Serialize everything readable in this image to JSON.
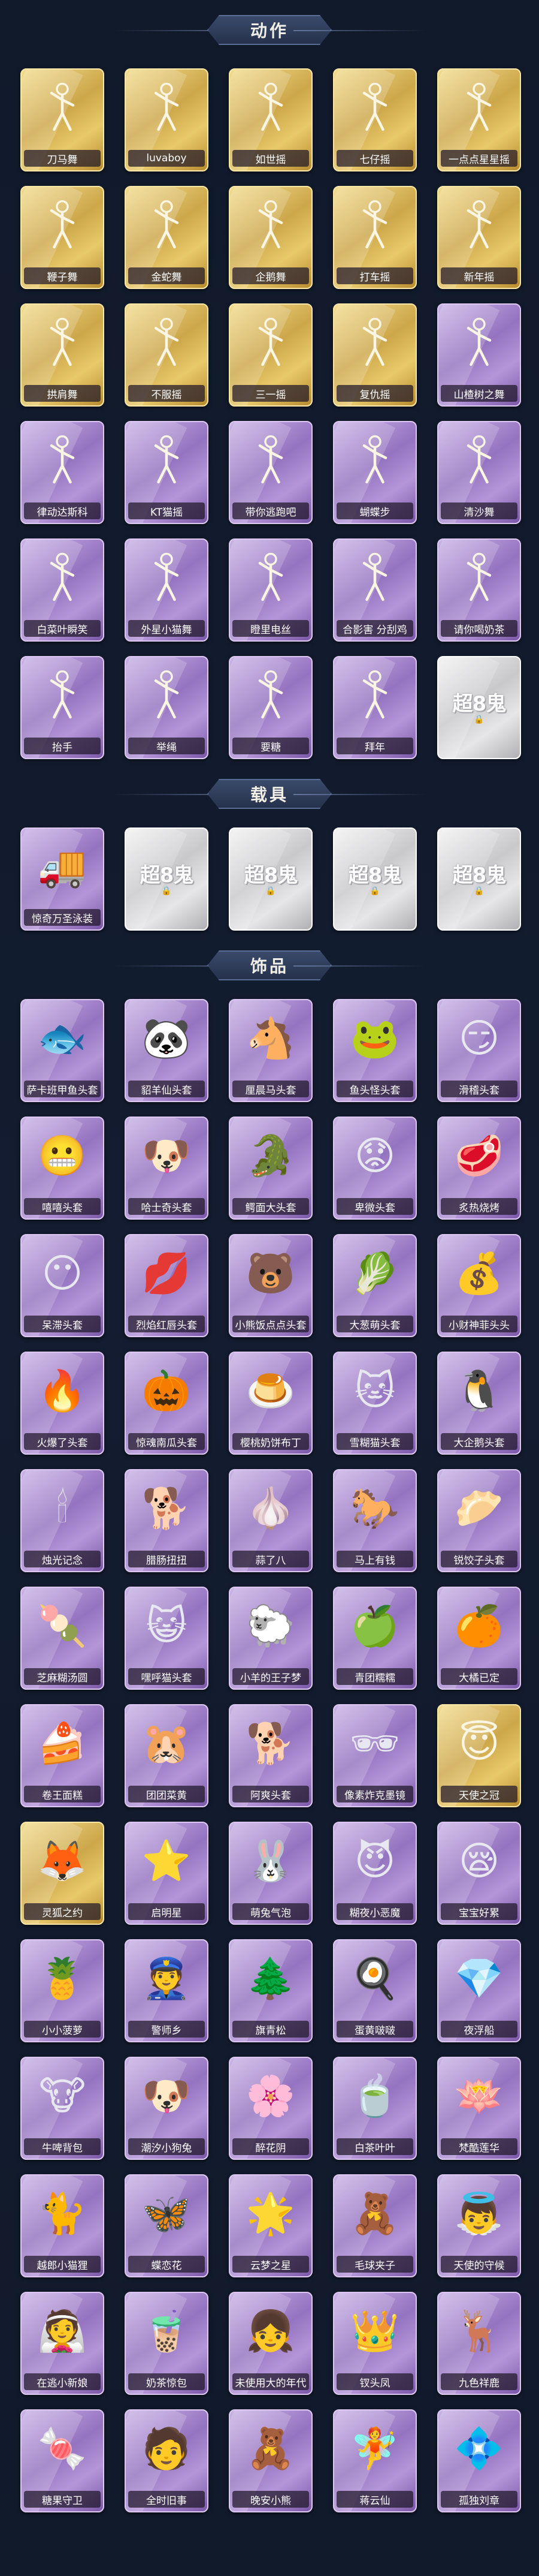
{
  "sections": {
    "actions": {
      "title": "动作"
    },
    "vehicles": {
      "title": "载具"
    },
    "accessories": {
      "title": "饰品"
    }
  },
  "locked_badge": "超8鬼",
  "actions": [
    {
      "label": "刀马舞",
      "rarity": "gold",
      "icon": "pose-icon"
    },
    {
      "label": "luvaboy",
      "rarity": "gold",
      "icon": "pose-icon"
    },
    {
      "label": "如世摇",
      "rarity": "gold",
      "icon": "pose-icon"
    },
    {
      "label": "七仔摇",
      "rarity": "gold",
      "icon": "pose-icon"
    },
    {
      "label": "一点点星星摇",
      "rarity": "gold",
      "icon": "pose-icon"
    },
    {
      "label": "鞭子舞",
      "rarity": "gold",
      "icon": "pose-icon"
    },
    {
      "label": "金蛇舞",
      "rarity": "gold",
      "icon": "pose-icon"
    },
    {
      "label": "企鹅舞",
      "rarity": "gold",
      "icon": "pose-icon"
    },
    {
      "label": "打车摇",
      "rarity": "gold",
      "icon": "pose-icon"
    },
    {
      "label": "新年摇",
      "rarity": "gold",
      "icon": "pose-icon"
    },
    {
      "label": "拱肩舞",
      "rarity": "gold",
      "icon": "pose-icon"
    },
    {
      "label": "不服摇",
      "rarity": "gold",
      "icon": "pose-icon"
    },
    {
      "label": "三一摇",
      "rarity": "gold",
      "icon": "pose-icon"
    },
    {
      "label": "复仇摇",
      "rarity": "gold",
      "icon": "pose-icon"
    },
    {
      "label": "山楂树之舞",
      "rarity": "purple",
      "icon": "pose-icon"
    },
    {
      "label": "律动达斯科",
      "rarity": "purple",
      "icon": "pose-icon"
    },
    {
      "label": "KT猫摇",
      "rarity": "purple",
      "icon": "pose-icon"
    },
    {
      "label": "带你逃跑吧",
      "rarity": "purple",
      "icon": "pose-icon"
    },
    {
      "label": "蝴蝶步",
      "rarity": "purple",
      "icon": "pose-icon"
    },
    {
      "label": "清沙舞",
      "rarity": "purple",
      "icon": "pose-icon"
    },
    {
      "label": "白菜叶瞬笑",
      "rarity": "purple",
      "icon": "pose-icon"
    },
    {
      "label": "外星小猫舞",
      "rarity": "purple",
      "icon": "pose-icon"
    },
    {
      "label": "瞪里电丝",
      "rarity": "purple",
      "icon": "pose-icon"
    },
    {
      "label": "合影害 分刮鸡",
      "rarity": "purple",
      "icon": "pose-icon"
    },
    {
      "label": "请你喝奶茶",
      "rarity": "purple",
      "icon": "pose-icon"
    },
    {
      "label": "抬手",
      "rarity": "purple",
      "icon": "pose-icon"
    },
    {
      "label": "举绳",
      "rarity": "purple",
      "icon": "pose-icon"
    },
    {
      "label": "要糖",
      "rarity": "purple",
      "icon": "pose-icon"
    },
    {
      "label": "拜年",
      "rarity": "purple",
      "icon": "pose-icon"
    },
    {
      "label": "",
      "rarity": "gray",
      "icon": "locked-icon"
    }
  ],
  "vehicles": [
    {
      "label": "惊奇万圣泳装",
      "rarity": "purple",
      "icon": "truck-icon",
      "glyph": "🚚"
    },
    {
      "label": "",
      "rarity": "gray",
      "icon": "locked-icon"
    },
    {
      "label": "",
      "rarity": "gray",
      "icon": "locked-icon"
    },
    {
      "label": "",
      "rarity": "gray",
      "icon": "locked-icon"
    },
    {
      "label": "",
      "rarity": "gray",
      "icon": "locked-icon"
    }
  ],
  "accessories": [
    {
      "label": "萨卡班甲鱼头套",
      "rarity": "purple",
      "icon": "fish-head-icon",
      "glyph": "🐟"
    },
    {
      "label": "貂羊仙头套",
      "rarity": "purple",
      "icon": "panda-head-icon",
      "glyph": "🐼"
    },
    {
      "label": "厘晨马头套",
      "rarity": "purple",
      "icon": "horse-head-icon",
      "glyph": "🐴"
    },
    {
      "label": "鱼头怪头套",
      "rarity": "purple",
      "icon": "fish-monster-icon",
      "glyph": "🐸"
    },
    {
      "label": "滑稽头套",
      "rarity": "purple",
      "icon": "funny-face-icon",
      "glyph": "😏"
    },
    {
      "label": "嘻嘻头套",
      "rarity": "purple",
      "icon": "grin-face-icon",
      "glyph": "😬"
    },
    {
      "label": "哈士奇头套",
      "rarity": "purple",
      "icon": "husky-head-icon",
      "glyph": "🐶"
    },
    {
      "label": "鳄面大头套",
      "rarity": "purple",
      "icon": "crocodile-head-icon",
      "glyph": "🐊"
    },
    {
      "label": "卑微头套",
      "rarity": "purple",
      "icon": "humble-face-icon",
      "glyph": "😟"
    },
    {
      "label": "炙热烧烤",
      "rarity": "purple",
      "icon": "bbq-icon",
      "glyph": "🥩"
    },
    {
      "label": "呆滞头套",
      "rarity": "purple",
      "icon": "dazed-face-icon",
      "glyph": "😶"
    },
    {
      "label": "烈焰红唇头套",
      "rarity": "purple",
      "icon": "red-lips-icon",
      "glyph": "💋"
    },
    {
      "label": "小熊饭点点头套",
      "rarity": "purple",
      "icon": "bear-head-icon",
      "glyph": "🐻"
    },
    {
      "label": "大葱萌头套",
      "rarity": "purple",
      "icon": "scallion-head-icon",
      "glyph": "🥬"
    },
    {
      "label": "小财神菲头头",
      "rarity": "purple",
      "icon": "fortune-god-icon",
      "glyph": "💰"
    },
    {
      "label": "火爆了头套",
      "rarity": "purple",
      "icon": "fire-head-icon",
      "glyph": "🔥"
    },
    {
      "label": "惊魂南瓜头套",
      "rarity": "purple",
      "icon": "pumpkin-head-icon",
      "glyph": "🎃"
    },
    {
      "label": "樱桃奶饼布丁",
      "rarity": "purple",
      "icon": "pudding-icon",
      "glyph": "🍮"
    },
    {
      "label": "雪糊猫头套",
      "rarity": "purple",
      "icon": "snow-cat-icon",
      "glyph": "🐱"
    },
    {
      "label": "大企鹅头套",
      "rarity": "purple",
      "icon": "penguin-head-icon",
      "glyph": "🐧"
    },
    {
      "label": "烛光记念",
      "rarity": "purple",
      "icon": "candle-icon",
      "glyph": "🕯"
    },
    {
      "label": "腊肠扭扭",
      "rarity": "purple",
      "icon": "dachshund-icon",
      "glyph": "🐕"
    },
    {
      "label": "蒜了八",
      "rarity": "purple",
      "icon": "garlic-icon",
      "glyph": "🧄"
    },
    {
      "label": "马上有钱",
      "rarity": "purple",
      "icon": "money-horse-icon",
      "glyph": "🐎"
    },
    {
      "label": "锐饺子头套",
      "rarity": "purple",
      "icon": "dumpling-icon",
      "glyph": "🥟"
    },
    {
      "label": "芝麻糊汤圆",
      "rarity": "purple",
      "icon": "rice-ball-icon",
      "glyph": "🍡"
    },
    {
      "label": "嘿呼猫头套",
      "rarity": "purple",
      "icon": "cat-head-icon",
      "glyph": "😺"
    },
    {
      "label": "小羊的王子梦",
      "rarity": "purple",
      "icon": "sheep-prince-icon",
      "glyph": "🐑"
    },
    {
      "label": "青团糯糯",
      "rarity": "purple",
      "icon": "green-rice-cake-icon",
      "glyph": "🍏"
    },
    {
      "label": "大橘已定",
      "rarity": "purple",
      "icon": "orange-icon",
      "glyph": "🍊"
    },
    {
      "label": "卷王面糕",
      "rarity": "purple",
      "icon": "roll-cake-icon",
      "glyph": "🍰"
    },
    {
      "label": "团团菜黄",
      "rarity": "purple",
      "icon": "hamster-icon",
      "glyph": "🐹"
    },
    {
      "label": "阿爽头套",
      "rarity": "purple",
      "icon": "shiba-head-icon",
      "glyph": "🐕"
    },
    {
      "label": "像素炸克墨镜",
      "rarity": "purple",
      "icon": "pixel-glasses-icon",
      "glyph": "🕶"
    },
    {
      "label": "天使之冠",
      "rarity": "gold",
      "icon": "angel-halo-icon",
      "glyph": "😇"
    },
    {
      "label": "灵狐之约",
      "rarity": "gold",
      "icon": "fox-icon",
      "glyph": "🦊"
    },
    {
      "label": "启明星",
      "rarity": "purple",
      "icon": "morning-star-icon",
      "glyph": "⭐"
    },
    {
      "label": "萌兔气泡",
      "rarity": "purple",
      "icon": "bunny-bubble-icon",
      "glyph": "🐰"
    },
    {
      "label": "糊夜小恶魔",
      "rarity": "purple",
      "icon": "little-devil-icon",
      "glyph": "😈"
    },
    {
      "label": "宝宝好累",
      "rarity": "purple",
      "icon": "tired-baby-icon",
      "glyph": "😪"
    },
    {
      "label": "小小菠萝",
      "rarity": "purple",
      "icon": "pineapple-icon",
      "glyph": "🍍"
    },
    {
      "label": "警师乡",
      "rarity": "purple",
      "icon": "police-doll-icon",
      "glyph": "👮"
    },
    {
      "label": "旗青松",
      "rarity": "purple",
      "icon": "pine-tree-icon",
      "glyph": "🌲"
    },
    {
      "label": "蛋黄啵啵",
      "rarity": "purple",
      "icon": "egg-yolk-icon",
      "glyph": "🍳"
    },
    {
      "label": "夜浮船",
      "rarity": "purple",
      "icon": "crystal-icon",
      "glyph": "💎"
    },
    {
      "label": "牛啤背包",
      "rarity": "purple",
      "icon": "cow-backpack-icon",
      "glyph": "🐮"
    },
    {
      "label": "潮汐小狗兔",
      "rarity": "purple",
      "icon": "blue-dog-icon",
      "glyph": "🐶"
    },
    {
      "label": "醉花阴",
      "rarity": "purple",
      "icon": "flower-pendant-icon",
      "glyph": "🌸"
    },
    {
      "label": "白茶叶叶",
      "rarity": "purple",
      "icon": "white-tea-icon",
      "glyph": "🍵"
    },
    {
      "label": "梵酷莲华",
      "rarity": "purple",
      "icon": "lotus-icon",
      "glyph": "🪷"
    },
    {
      "label": "越郎小猫狸",
      "rarity": "purple",
      "icon": "cat-doll-icon",
      "glyph": "🐈"
    },
    {
      "label": "蝶恋花",
      "rarity": "purple",
      "icon": "butterfly-icon",
      "glyph": "🦋"
    },
    {
      "label": "云梦之星",
      "rarity": "purple",
      "icon": "cloud-star-icon",
      "glyph": "🌟"
    },
    {
      "label": "毛球夹子",
      "rarity": "purple",
      "icon": "hair-clip-icon",
      "glyph": "🧸"
    },
    {
      "label": "天使的守候",
      "rarity": "purple",
      "icon": "angel-doll-icon",
      "glyph": "👼"
    },
    {
      "label": "在逃小新娘",
      "rarity": "purple",
      "icon": "bride-doll-icon",
      "glyph": "👰"
    },
    {
      "label": "奶茶惊包",
      "rarity": "purple",
      "icon": "milk-tea-bag-icon",
      "glyph": "🧋"
    },
    {
      "label": "未使用大的年代",
      "rarity": "purple",
      "icon": "girl-doll-icon",
      "glyph": "👧"
    },
    {
      "label": "钗头凤",
      "rarity": "purple",
      "icon": "phoenix-hairpin-icon",
      "glyph": "👑"
    },
    {
      "label": "九色祥鹿",
      "rarity": "purple",
      "icon": "deer-icon",
      "glyph": "🦌"
    },
    {
      "label": "糖果守卫",
      "rarity": "purple",
      "icon": "candy-guard-icon",
      "glyph": "🍬"
    },
    {
      "label": "全时旧事",
      "rarity": "purple",
      "icon": "boy-doll-icon",
      "glyph": "🧑"
    },
    {
      "label": "晚安小熊",
      "rarity": "purple",
      "icon": "sleepy-bear-icon",
      "glyph": "🧸"
    },
    {
      "label": "蒋云仙",
      "rarity": "purple",
      "icon": "fairy-doll-icon",
      "glyph": "🧚"
    },
    {
      "label": "孤独刘章",
      "rarity": "purple",
      "icon": "crystal-pendant-icon",
      "glyph": "💠"
    }
  ]
}
